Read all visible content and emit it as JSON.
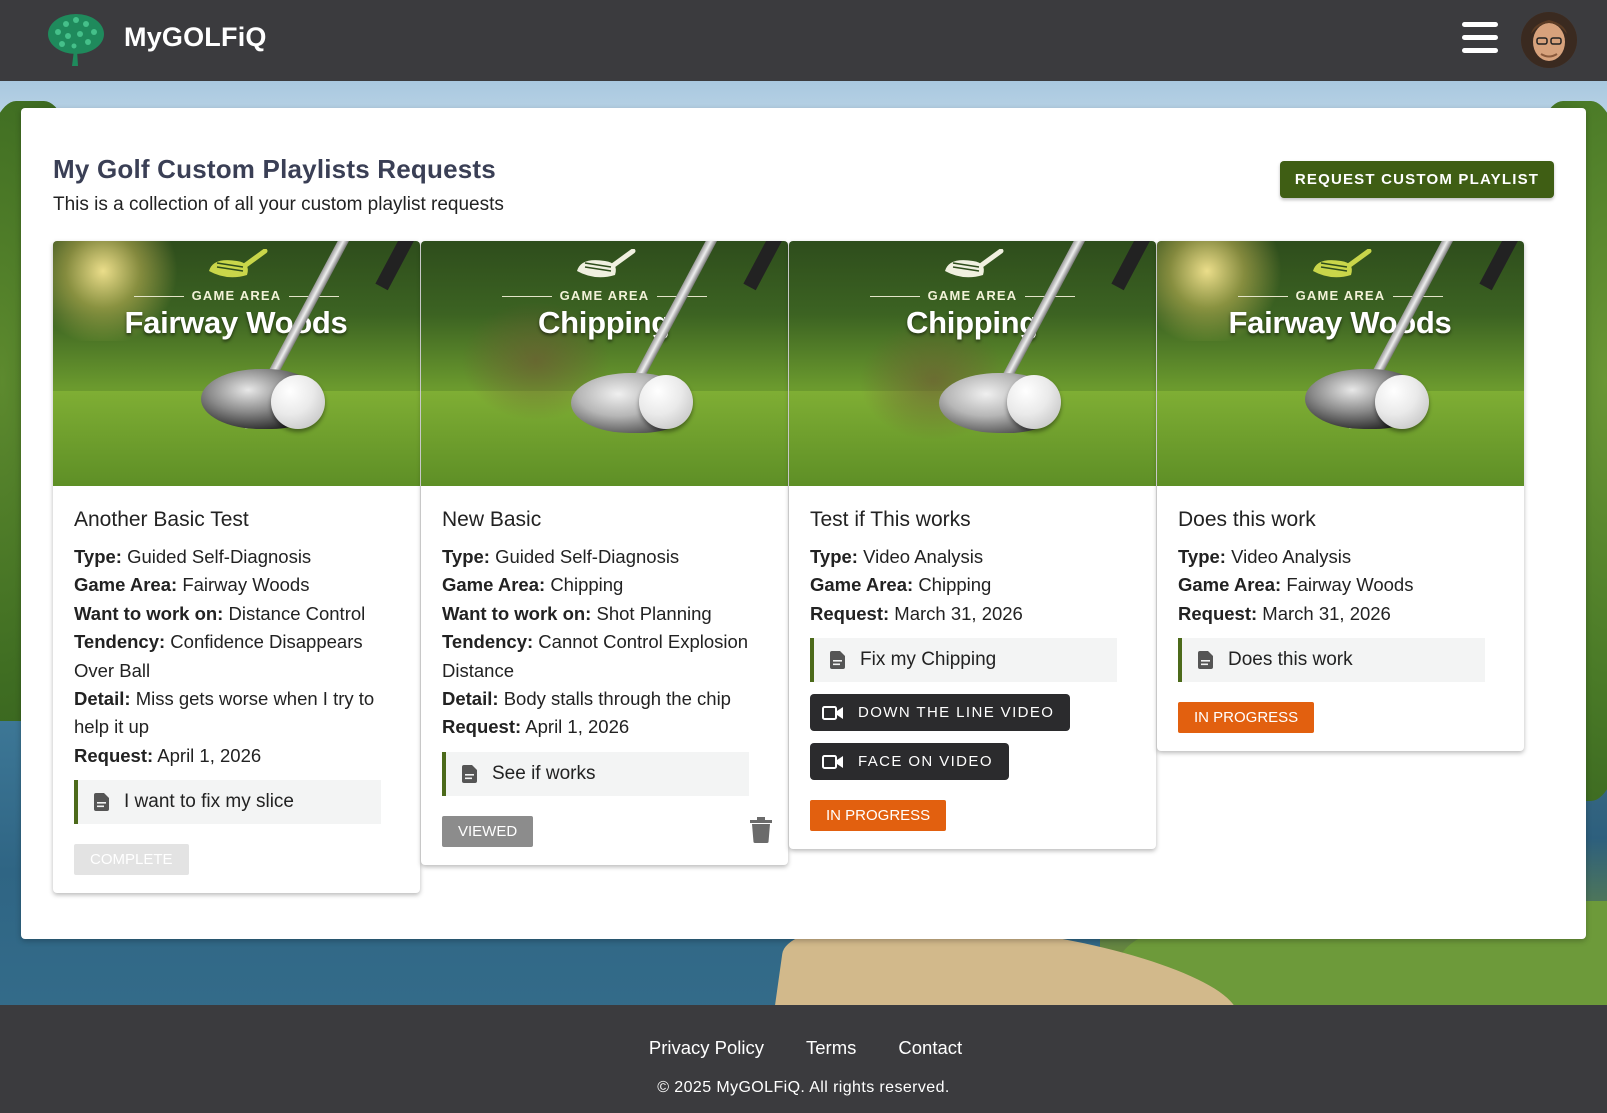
{
  "header": {
    "brand": "MyGOLFiQ",
    "logo_icon": "tree-logo-icon",
    "menu_icon": "hamburger-menu-icon"
  },
  "page": {
    "title": "My Golf Custom Playlists Requests",
    "subtitle": "This is a collection of all your custom playlist requests",
    "request_button": "REQUEST CUSTOM PLAYLIST"
  },
  "labels": {
    "type": "Type:",
    "game_area": "Game Area:",
    "want": "Want to work on:",
    "tendency": "Tendency:",
    "detail": "Detail:",
    "request": "Request:",
    "image_game_area": "GAME AREA"
  },
  "cards": [
    {
      "image_title": "Fairway Woods",
      "title": "Another Basic Test",
      "type": "Guided Self-Diagnosis",
      "game_area": "Fairway Woods",
      "want": "Distance Control",
      "tendency": "Confidence Disappears Over Ball",
      "detail": "Miss gets worse when I try to help it up",
      "request": "April 1, 2026",
      "note": "I want to fix my slice",
      "status": "COMPLETE"
    },
    {
      "image_title": "Chipping",
      "title": "New Basic",
      "type": "Guided Self-Diagnosis",
      "game_area": "Chipping",
      "want": "Shot Planning",
      "tendency": "Cannot Control Explosion Distance",
      "detail": "Body stalls through the chip",
      "request": "April 1, 2026",
      "note": "See if works",
      "status": "VIEWED"
    },
    {
      "image_title": "Chipping",
      "title": "Test if This works",
      "type": "Video Analysis",
      "game_area": "Chipping",
      "request": "March 31, 2026",
      "note": "Fix my Chipping",
      "video_buttons": [
        "DOWN THE LINE VIDEO",
        "FACE ON VIDEO"
      ],
      "status": "IN PROGRESS"
    },
    {
      "image_title": "Fairway Woods",
      "title": "Does this work",
      "type": "Video Analysis",
      "game_area": "Fairway Woods",
      "request": "March 31, 2026",
      "note": "Does this work",
      "status": "IN PROGRESS"
    }
  ],
  "colors": {
    "header_bg": "#3b3b3e",
    "primary_button": "#3f5e14",
    "status_progress": "#e2600f",
    "status_viewed": "#8c8c8c",
    "status_complete": "#e3e3e3",
    "note_border": "#4c6a1a"
  },
  "footer": {
    "links": [
      "Privacy Policy",
      "Terms",
      "Contact"
    ],
    "copyright": "© 2025 MyGOLFiQ. All rights reserved."
  }
}
